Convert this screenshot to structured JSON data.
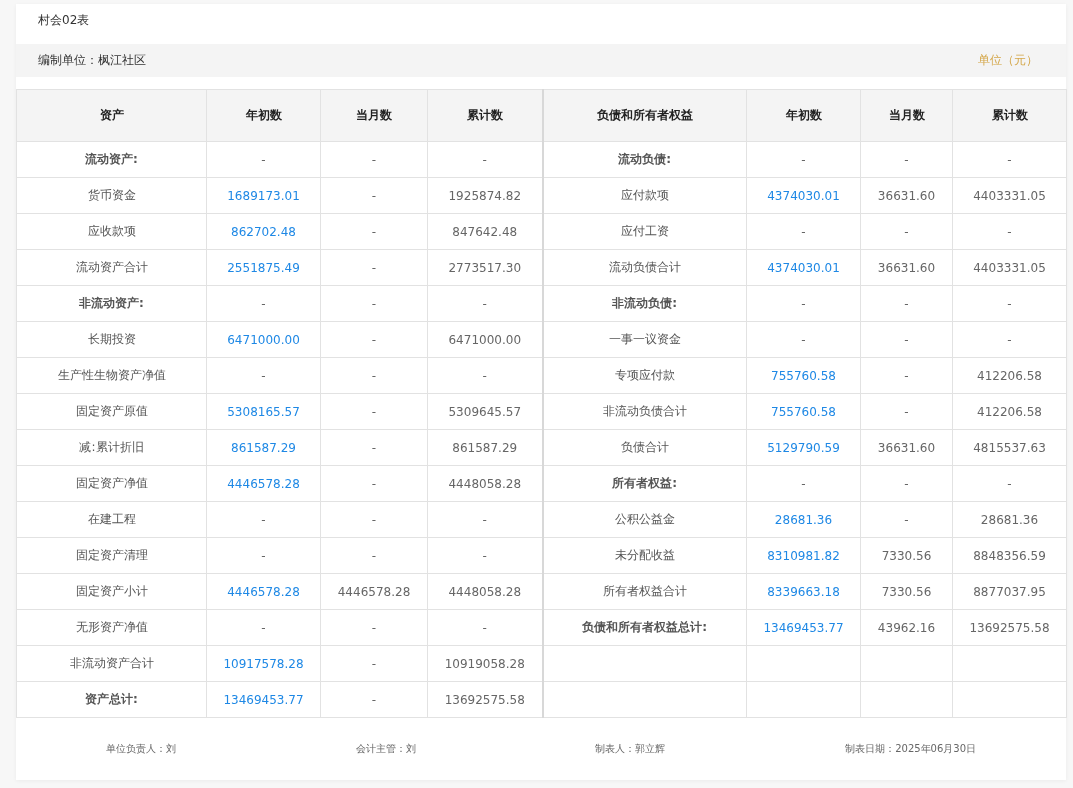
{
  "form_code": "村会02表",
  "compiler": "编制单位：枫江社区",
  "unit": "单位（元）",
  "columns": [
    "资产",
    "年初数",
    "当月数",
    "累计数",
    "负债和所有者权益",
    "年初数",
    "当月数",
    "累计数"
  ],
  "rows": [
    {
      "left": {
        "label": "流动资产:",
        "bold": true,
        "linked": false,
        "initial": "-",
        "month": "-",
        "cumulative": "-"
      },
      "right": {
        "label": "流动负债:",
        "bold": true,
        "linked": false,
        "initial": "-",
        "month": "-",
        "cumulative": "-"
      }
    },
    {
      "left": {
        "label": "货币资金",
        "bold": false,
        "linked": true,
        "initial": "1689173.01",
        "month": "-",
        "cumulative": "1925874.82"
      },
      "right": {
        "label": "应付款项",
        "bold": false,
        "linked": true,
        "initial": "4374030.01",
        "month": "36631.60",
        "cumulative": "4403331.05"
      }
    },
    {
      "left": {
        "label": "应收款项",
        "bold": false,
        "linked": true,
        "initial": "862702.48",
        "month": "-",
        "cumulative": "847642.48"
      },
      "right": {
        "label": "应付工资",
        "bold": false,
        "linked": false,
        "initial": "-",
        "month": "-",
        "cumulative": "-"
      }
    },
    {
      "left": {
        "label": "流动资产合计",
        "bold": false,
        "linked": true,
        "initial": "2551875.49",
        "month": "-",
        "cumulative": "2773517.30"
      },
      "right": {
        "label": "流动负债合计",
        "bold": false,
        "linked": true,
        "initial": "4374030.01",
        "month": "36631.60",
        "cumulative": "4403331.05"
      }
    },
    {
      "left": {
        "label": "非流动资产:",
        "bold": true,
        "linked": false,
        "initial": "-",
        "month": "-",
        "cumulative": "-"
      },
      "right": {
        "label": "非流动负债:",
        "bold": true,
        "linked": false,
        "initial": "-",
        "month": "-",
        "cumulative": "-"
      }
    },
    {
      "left": {
        "label": "长期投资",
        "bold": false,
        "linked": true,
        "initial": "6471000.00",
        "month": "-",
        "cumulative": "6471000.00"
      },
      "right": {
        "label": "一事一议资金",
        "bold": false,
        "linked": false,
        "initial": "-",
        "month": "-",
        "cumulative": "-"
      }
    },
    {
      "left": {
        "label": "生产性生物资产净值",
        "bold": false,
        "linked": false,
        "initial": "-",
        "month": "-",
        "cumulative": "-"
      },
      "right": {
        "label": "专项应付款",
        "bold": false,
        "linked": true,
        "initial": "755760.58",
        "month": "-",
        "cumulative": "412206.58"
      }
    },
    {
      "left": {
        "label": "固定资产原值",
        "bold": false,
        "linked": true,
        "initial": "5308165.57",
        "month": "-",
        "cumulative": "5309645.57"
      },
      "right": {
        "label": "非流动负债合计",
        "bold": false,
        "linked": true,
        "initial": "755760.58",
        "month": "-",
        "cumulative": "412206.58"
      }
    },
    {
      "left": {
        "label": "减:累计折旧",
        "bold": false,
        "linked": true,
        "initial": "861587.29",
        "month": "-",
        "cumulative": "861587.29"
      },
      "right": {
        "label": "负债合计",
        "bold": false,
        "linked": true,
        "initial": "5129790.59",
        "month": "36631.60",
        "cumulative": "4815537.63"
      }
    },
    {
      "left": {
        "label": "固定资产净值",
        "bold": false,
        "linked": true,
        "initial": "4446578.28",
        "month": "-",
        "cumulative": "4448058.28"
      },
      "right": {
        "label": "所有者权益:",
        "bold": true,
        "linked": false,
        "initial": "-",
        "month": "-",
        "cumulative": "-"
      }
    },
    {
      "left": {
        "label": "在建工程",
        "bold": false,
        "linked": false,
        "initial": "-",
        "month": "-",
        "cumulative": "-"
      },
      "right": {
        "label": "公积公益金",
        "bold": false,
        "linked": true,
        "initial": "28681.36",
        "month": "-",
        "cumulative": "28681.36"
      }
    },
    {
      "left": {
        "label": "固定资产清理",
        "bold": false,
        "linked": false,
        "initial": "-",
        "month": "-",
        "cumulative": "-"
      },
      "right": {
        "label": "未分配收益",
        "bold": false,
        "linked": true,
        "initial": "8310981.82",
        "month": "7330.56",
        "cumulative": "8848356.59"
      }
    },
    {
      "left": {
        "label": "固定资产小计",
        "bold": false,
        "linked": true,
        "initial": "4446578.28",
        "month": "4446578.28",
        "cumulative": "4448058.28"
      },
      "right": {
        "label": "所有者权益合计",
        "bold": false,
        "linked": true,
        "initial": "8339663.18",
        "month": "7330.56",
        "cumulative": "8877037.95"
      }
    },
    {
      "left": {
        "label": "无形资产净值",
        "bold": false,
        "linked": false,
        "initial": "-",
        "month": "-",
        "cumulative": "-"
      },
      "right": {
        "label": "负债和所有者权益总计:",
        "bold": true,
        "linked": true,
        "initial": "13469453.77",
        "month": "43962.16",
        "cumulative": "13692575.58"
      }
    },
    {
      "left": {
        "label": "非流动资产合计",
        "bold": false,
        "linked": true,
        "initial": "10917578.28",
        "month": "-",
        "cumulative": "10919058.28"
      },
      "right": null
    },
    {
      "left": {
        "label": "资产总计:",
        "bold": true,
        "linked": true,
        "initial": "13469453.77",
        "month": "-",
        "cumulative": "13692575.58"
      },
      "right": null
    }
  ],
  "signatures": [
    "单位负责人：刘",
    "会计主管：刘",
    "制表人：郭立辉",
    "制表日期：2025年06月30日"
  ]
}
